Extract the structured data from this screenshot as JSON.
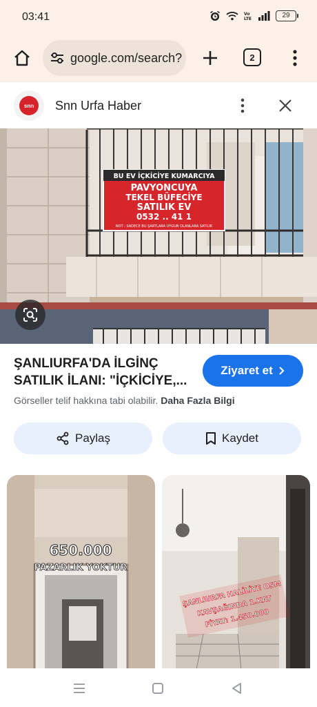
{
  "status_bar": {
    "time": "03:41",
    "battery": "29",
    "icons": [
      "alarm-icon",
      "wifi-icon",
      "volte-icon",
      "signal-icon",
      "battery-icon"
    ]
  },
  "browser": {
    "url": "google.com/search?",
    "tab_count": "2",
    "icons": [
      "home-icon",
      "tune-icon",
      "plus-icon",
      "more-vert-icon"
    ]
  },
  "source": {
    "name": "Snn Urfa Haber",
    "logo_text": "snn"
  },
  "image_text": {
    "line1": "BU EV İÇKİCİYE KUMARCIYA",
    "line2": "PAVYONCUYA",
    "line3": "TEKEL BÜFECİYE",
    "line4": "SATILIK EV",
    "line5": "0532 .. 41 1",
    "line6": "NOT : SADECE BU ŞARTLARA UYGUN OLANLARA SATILIK"
  },
  "result": {
    "title": "ŞANLIURFA'DA İLGİNÇ SATILIK İLANI: \"İÇKİCİYE,...",
    "visit_label": "Ziyaret et",
    "copyright_text": "Görseller telif hakkına tabi olabilir.",
    "more_info_label": "Daha Fazla Bilgi",
    "share_label": "Paylaş",
    "save_label": "Kaydet"
  },
  "related": [
    {
      "price": "650.000",
      "note": "PAZARLIK YOKTUR"
    },
    {
      "line1": "ŞANLIURFA HALİLİYE OSM",
      "line2": "KAVŞAĞINDA 1.KAT",
      "line3": "FİYAT: 1.450.000"
    }
  ],
  "colors": {
    "chrome_bg": "#fbf1e8",
    "accent": "#1a73e8",
    "chip_bg": "#e8f0fe",
    "sign_red": "#d7262b"
  }
}
